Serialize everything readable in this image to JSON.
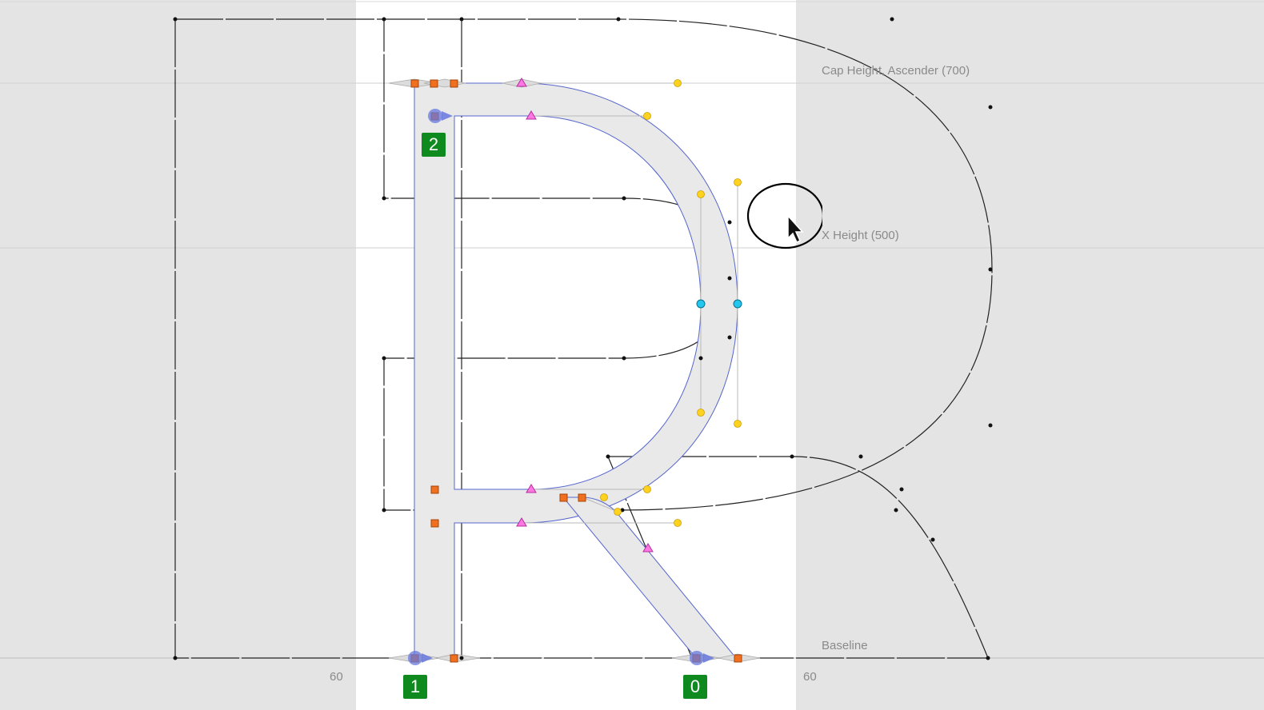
{
  "metrics": {
    "cap_height": "Cap Height, Ascender (700)",
    "x_height": "X Height (500)",
    "baseline": "Baseline"
  },
  "sidebearings": {
    "left": "60",
    "right": "60"
  },
  "start_points": [
    {
      "label": "2",
      "kind": "contour-start-index"
    },
    {
      "label": "1",
      "kind": "contour-start-index"
    },
    {
      "label": "0",
      "kind": "contour-start-index"
    }
  ],
  "colors": {
    "canvas_outside": "#e4e4e4",
    "glyph_area": "#ffffff",
    "outline_fill": "#e9e9e9",
    "path_stroke": "#5566cc",
    "on_curve_corner": "#f07020",
    "off_curve_handle": "#ffd21f",
    "smooth_point": "#ff66dd",
    "extremum_point": "#22c6ee",
    "index_badge": "#0e8a1e"
  },
  "icons": {
    "cursor": "arrow-pointer-icon",
    "start_marker": "direction-arrow-icon"
  }
}
